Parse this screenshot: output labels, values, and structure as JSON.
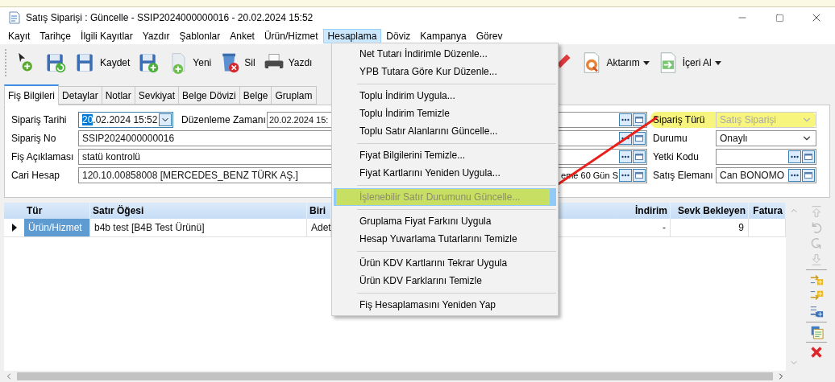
{
  "window": {
    "title": "Satış Siparişi : Güncelle - SSIP2024000000016 - 20.02.2024 15:52"
  },
  "menu_bar": [
    {
      "label": "Kayıt",
      "selected": false
    },
    {
      "label": "Tarihçe",
      "selected": false
    },
    {
      "label": "İlgili Kayıtlar",
      "selected": false
    },
    {
      "label": "Yazdır",
      "selected": false
    },
    {
      "label": "Şablonlar",
      "selected": false
    },
    {
      "label": "Anket",
      "selected": false
    },
    {
      "label": "Ürün/Hizmet",
      "selected": false
    },
    {
      "label": "Hesaplama",
      "selected": true
    },
    {
      "label": "Döviz",
      "selected": false
    },
    {
      "label": "Kampanya",
      "selected": false
    },
    {
      "label": "Görev",
      "selected": false
    }
  ],
  "toolbar": {
    "visible_left": [
      {
        "kind": "add"
      },
      {
        "kind": "save-refresh"
      },
      {
        "kind": "save",
        "label": "Kaydet"
      },
      {
        "kind": "save-add"
      },
      {
        "kind": "new",
        "label": "Yeni"
      },
      {
        "kind": "delete",
        "label": "Sil"
      },
      {
        "kind": "print",
        "label": "Yazdı"
      }
    ],
    "visible_right": [
      {
        "kind": "edit"
      },
      {
        "kind": "export",
        "label": "Aktarım",
        "dropdown": true
      },
      {
        "kind": "import",
        "label": "İçeri Al",
        "dropdown": true
      }
    ]
  },
  "tabs": [
    {
      "label": "Fiş Bilgileri",
      "selected": true
    },
    {
      "label": "Detaylar",
      "selected": false
    },
    {
      "label": "Notlar",
      "selected": false
    },
    {
      "label": "Sevkiyat",
      "selected": false
    },
    {
      "label": "Belge Dövizi",
      "selected": false
    },
    {
      "label": "Belge",
      "selected": false
    },
    {
      "label": "Gruplam",
      "selected": false
    }
  ],
  "form": {
    "left": [
      {
        "label": "Sipariş Tarihi",
        "kind": "date",
        "value_selected": "20",
        "value": ".02.2024 15:52"
      },
      {
        "label": "Sipariş No",
        "kind": "text",
        "value": "SSIP2024000000016"
      },
      {
        "label": "Fiş Açıklaması",
        "kind": "text",
        "value": "statü kontrolü"
      },
      {
        "label": "Cari Hesap",
        "kind": "text",
        "value": "120.10.00858008 [MERCEDES_BENZ TÜRK AŞ.]"
      }
    ],
    "edit_time": {
      "label": "Düzenleme Zamanı",
      "value": "20.02.2024 15:"
    },
    "middle": [
      {
        "kind": "lookup"
      },
      {
        "kind": "lookup"
      },
      {
        "kind": "lookup"
      },
      {
        "kind": "lookup",
        "value": "eme 60 Gün S"
      }
    ],
    "right": [
      {
        "label": "Sipariş Türü",
        "kind": "select",
        "value": "Satış Siparişi",
        "disabled": true,
        "highlighted": true
      },
      {
        "label": "Durumu",
        "kind": "select",
        "value": "Onaylı",
        "disabled": false,
        "highlighted": false
      },
      {
        "label": "Yetki Kodu",
        "kind": "lookup",
        "disabled": false,
        "highlighted": false
      },
      {
        "label": "Satış Elemanı",
        "kind": "lookup",
        "value": "Can BONOMO",
        "disabled": false,
        "highlighted": false
      }
    ]
  },
  "grid": {
    "columns": [
      {
        "label": "Tür",
        "kind": "text"
      },
      {
        "label": "Satır Öğesi",
        "kind": "text"
      },
      {
        "label": "Biri",
        "kind": "text"
      },
      {
        "label": "İndirim",
        "kind": "number"
      },
      {
        "label": "Sevk Bekleyen",
        "kind": "number"
      },
      {
        "label": "Fatura",
        "kind": "number"
      }
    ],
    "rows": [
      {
        "current": true,
        "cells": [
          {
            "value": "Ürün/Hizmet",
            "selected": true
          },
          {
            "value": "b4b test [B4B Test Ürünü]",
            "selected": false
          },
          {
            "value": "Adet",
            "selected": false
          },
          {
            "value": "-",
            "selected": false
          },
          {
            "value": "9",
            "selected": false
          }
        ]
      }
    ]
  },
  "side_toolbar": [
    {
      "kind": "move-top",
      "disabled": true
    },
    {
      "kind": "undo",
      "disabled": true
    },
    {
      "kind": "redo",
      "disabled": true
    },
    {
      "kind": "move-bottom",
      "disabled": true
    },
    {
      "kind": "separator"
    },
    {
      "kind": "insert-after",
      "disabled": false
    },
    {
      "kind": "insert-before",
      "disabled": false
    },
    {
      "kind": "insert-list",
      "disabled": false
    },
    {
      "kind": "separator"
    },
    {
      "kind": "document",
      "disabled": false
    },
    {
      "kind": "separator"
    },
    {
      "kind": "delete",
      "disabled": false
    }
  ],
  "dropdown_menu": {
    "groups": [
      [
        {
          "label": "Net Tutarı İndirimle Düzenle...",
          "disabled": false,
          "selected": false,
          "marked": false
        },
        {
          "label": "YPB Tutara Göre Kur Düzenle...",
          "disabled": false,
          "selected": false,
          "marked": false
        }
      ],
      [
        {
          "label": "Toplu İndirim Uygula...",
          "disabled": false,
          "selected": false,
          "marked": false
        },
        {
          "label": "Toplu İndirim Temizle",
          "disabled": false,
          "selected": false,
          "marked": false
        },
        {
          "label": "Toplu Satır Alanlarını Güncelle...",
          "disabled": false,
          "selected": false,
          "marked": false
        }
      ],
      [
        {
          "label": "Fiyat Bilgilerini Temizle...",
          "disabled": false,
          "selected": false,
          "marked": false
        },
        {
          "label": "Fiyat Kartlarını Yeniden Uygula...",
          "disabled": false,
          "selected": false,
          "marked": false
        }
      ],
      [
        {
          "label": "İşlenebilir Satır Durumunu Güncelle...",
          "disabled": true,
          "selected": true,
          "marked": true
        }
      ],
      [
        {
          "label": "Gruplama Fiyat Farkını Uygula",
          "disabled": false,
          "selected": false,
          "marked": false
        },
        {
          "label": "Hesap Yuvarlama Tutarlarını Temizle",
          "disabled": false,
          "selected": false,
          "marked": false
        }
      ],
      [
        {
          "label": "Ürün KDV Kartlarını Tekrar Uygula",
          "disabled": false,
          "selected": false,
          "marked": false
        },
        {
          "label": "Ürün KDV Farklarını Temizle",
          "disabled": false,
          "selected": false,
          "marked": false
        }
      ],
      [
        {
          "label": "Fiş Hesaplamasını Yeniden Yap",
          "disabled": false,
          "selected": false,
          "marked": false
        }
      ]
    ]
  }
}
